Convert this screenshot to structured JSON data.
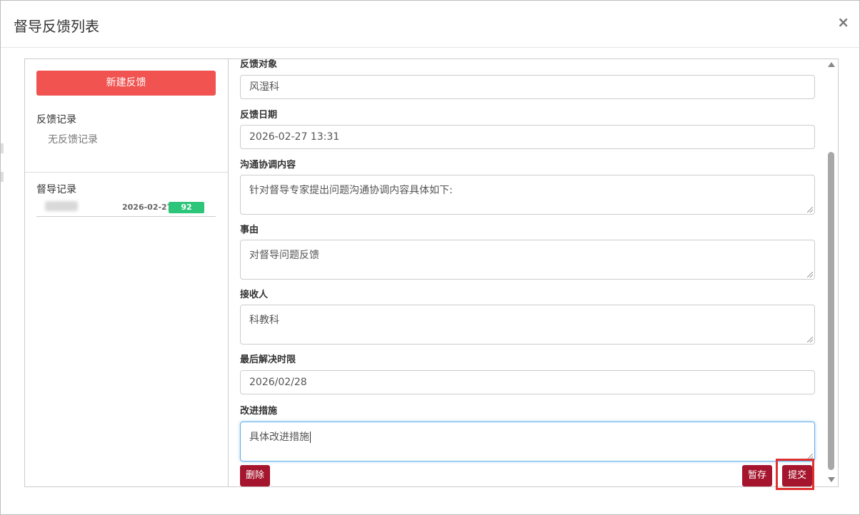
{
  "modal": {
    "title": "督导反馈列表",
    "close_label": "×"
  },
  "left": {
    "new_button": "新建反馈",
    "feedback_records_label": "反馈记录",
    "no_records": "无反馈记录",
    "supervision_records_label": "督导记录",
    "records": [
      {
        "date": "2026-02-27",
        "score": "92"
      }
    ]
  },
  "form": {
    "target_label": "反馈对象",
    "target_value": "风湿科",
    "date_label": "反馈日期",
    "date_value": "2026-02-27 13:31",
    "content_label": "沟通协调内容",
    "content_value": "针对督导专家提出问题沟通协调内容具体如下:",
    "reason_label": "事由",
    "reason_value": "对督导问题反馈",
    "receiver_label": "接收人",
    "receiver_value": "科教科",
    "deadline_label": "最后解决时限",
    "deadline_value": "2026/02/28",
    "measures_label": "改进措施",
    "measures_value": "具体改进措施"
  },
  "buttons": {
    "delete": "删除",
    "save_draft": "暂存",
    "submit": "提交"
  },
  "colors": {
    "new_button": "#f05350",
    "action_button": "#a5152d",
    "score_badge": "#2dc57a",
    "highlight": "#e03030"
  }
}
